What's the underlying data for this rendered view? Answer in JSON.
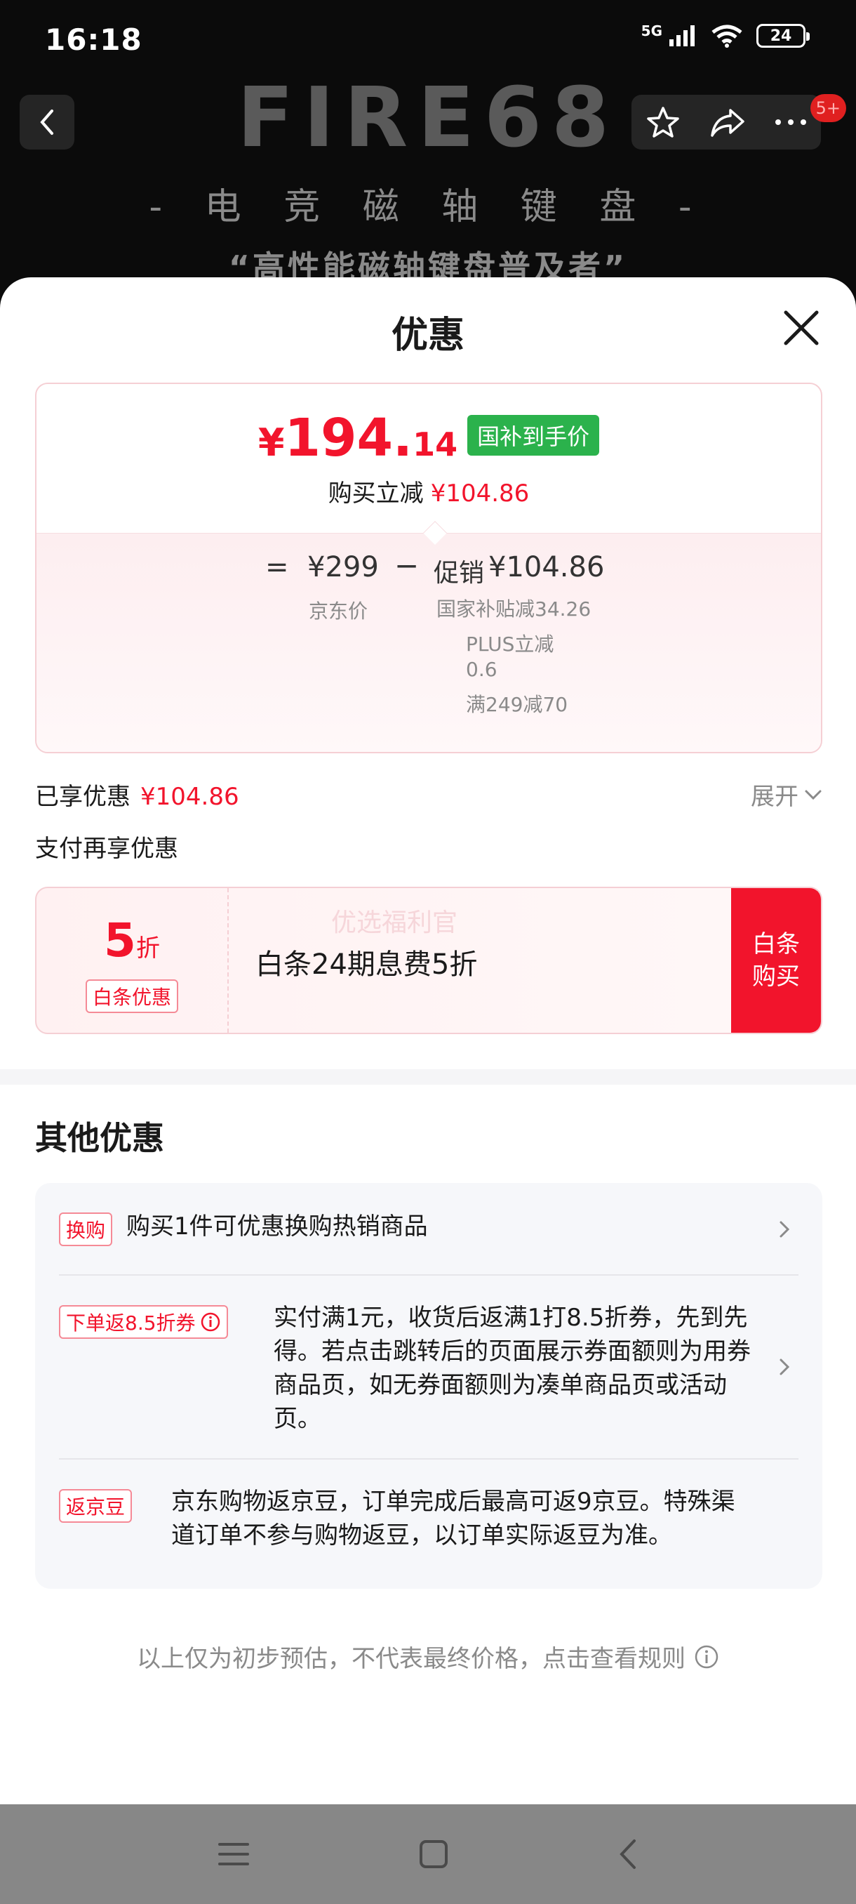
{
  "status_bar": {
    "time": "16:18",
    "network": "5G",
    "battery": "24"
  },
  "background_page": {
    "hero_logo": "FIRE68",
    "hero_subtitle": "- 电 竞 磁 轴 键 盘 -",
    "hero_tagline": "“高性能磁轴键盘普及者”",
    "cart_badge": "5+"
  },
  "sheet": {
    "title": "优惠",
    "price": {
      "currency": "¥",
      "integer": "194.",
      "decimal": "14",
      "tag": "国补到手价",
      "save_label": "购买立减",
      "save_value": "¥104.86"
    },
    "formula": {
      "equals": "=",
      "jd_price": "¥299",
      "jd_price_label": "京东价",
      "minus": "−",
      "promo_label": "促销",
      "promo_value": "¥104.86",
      "details": [
        "国家补贴减34.26",
        "PLUS立减",
        "0.6",
        "满249减70"
      ]
    },
    "enjoyed_label": "已享优惠",
    "enjoyed_value": "¥104.86",
    "expand_label": "展开",
    "pay_title": "支付再享优惠",
    "baitiao": {
      "discount_num": "5",
      "discount_unit": "折",
      "tag": "白条优惠",
      "watermark": "优选福利官",
      "text": "白条24期息费5折",
      "buy_line1": "白条",
      "buy_line2": "购买"
    },
    "other_title": "其他优惠",
    "other_items": [
      {
        "tag": "换购",
        "text": "购买1件可优惠换购热销商品"
      },
      {
        "tag": "下单返8.5折券",
        "text_lines": [
          "实付满1元，收货后返满1打8.5折券，先到先",
          "得。若点击跳转后的页面展示券面额则为用券",
          "商品页，如无券面额则为凑单商品页或活动",
          "页。"
        ]
      },
      {
        "tag": "返京豆",
        "text_lines": [
          "京东购物返京豆，订单完成后最高可返9京豆。特殊渠",
          "道订单不参与购物返豆，以订单实际返豆为准。"
        ]
      }
    ],
    "footnote": "以上仅为初步预估，不代表最终价格，点击查看规则"
  },
  "colors": {
    "accent_red": "#f2142c",
    "green_tag": "#2bb24c",
    "muted": "#8a8a8a"
  }
}
